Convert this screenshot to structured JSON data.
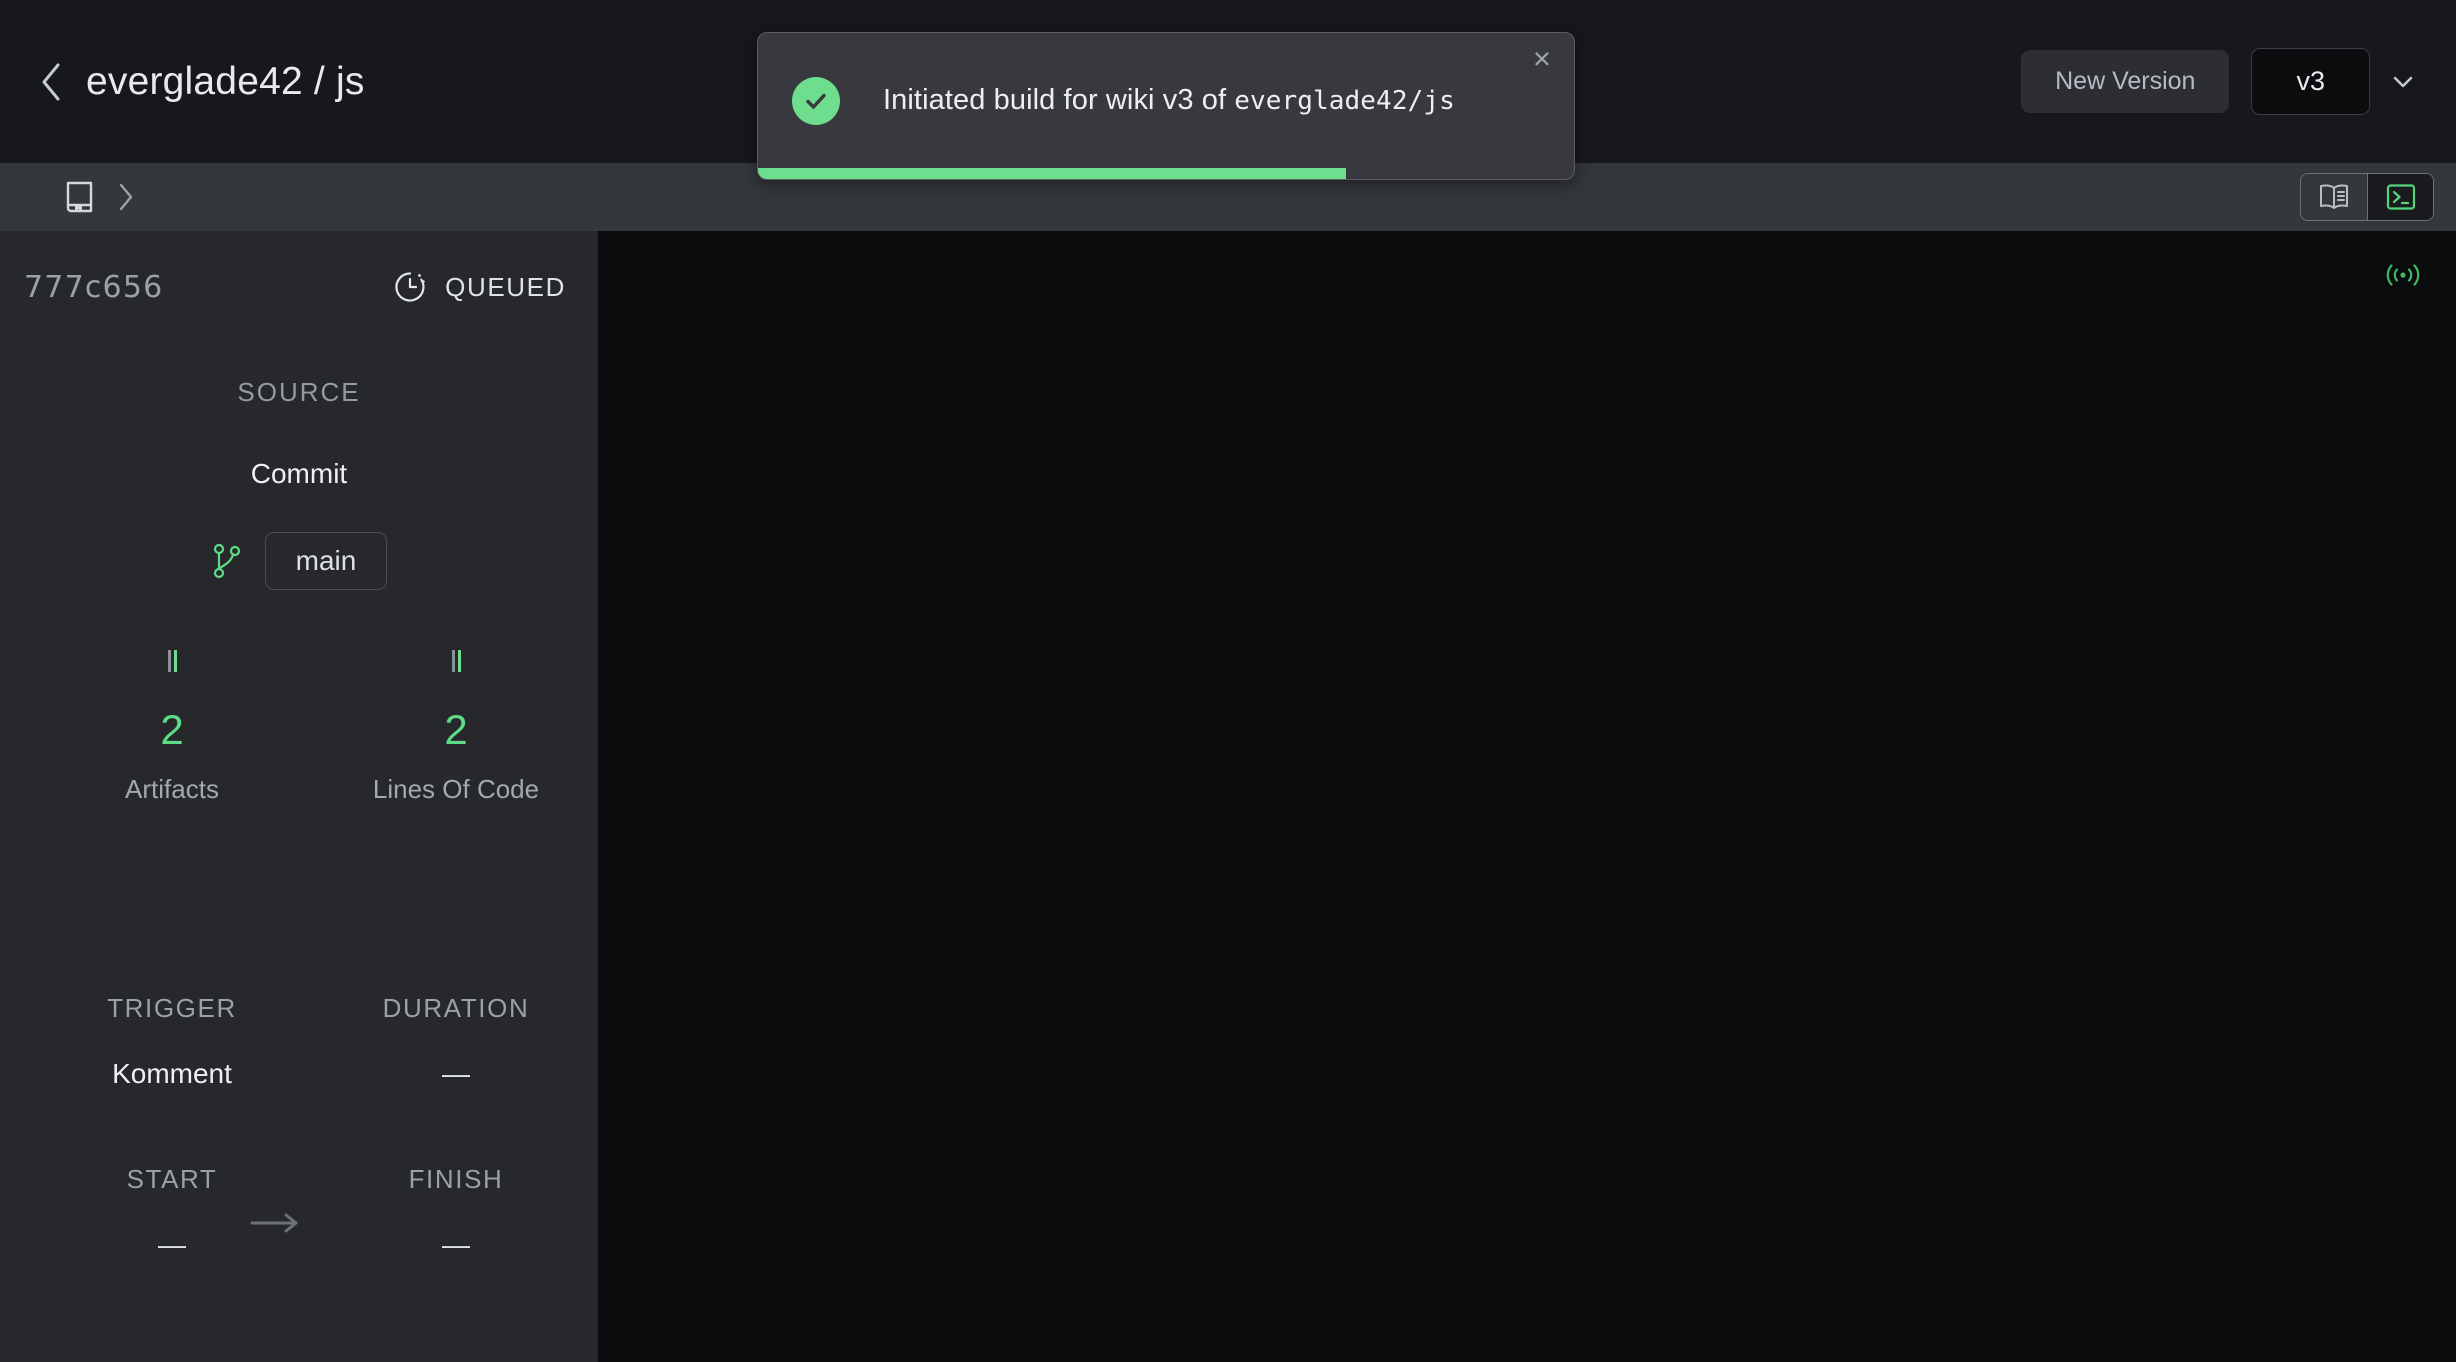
{
  "window": {
    "title": "everglade42 / js",
    "back_icon": "chevron-left-icon"
  },
  "topbar": {
    "new_version_label": "New Version",
    "version_value": "v3",
    "version_chevron_icon": "chevron-down-icon"
  },
  "toast": {
    "status_icon": "check-circle-icon",
    "message_prefix": "Initiated build for wiki v3 of ",
    "message_repo": "everglade42/js",
    "close_label": "×",
    "progress_percent": 72,
    "accent_color": "#6edd8e",
    "background_color": "#37393e"
  },
  "subbar": {
    "book_icon": "book-bookmark-icon",
    "separator_icon": "chevron-right-icon",
    "view_toggle": [
      {
        "icon": "book-open-icon",
        "label": "docs-view",
        "active": false
      },
      {
        "icon": "terminal-icon",
        "label": "terminal-view",
        "active": true
      }
    ]
  },
  "sidebar": {
    "commit_hash": "777c656",
    "status": {
      "icon": "clock-dashed-icon",
      "text": "QUEUED"
    },
    "source": {
      "section_label": "SOURCE",
      "type": "Commit",
      "branch_icon": "git-branch-icon",
      "branch": "main"
    },
    "stats": [
      {
        "value": "2",
        "label": "Artifacts",
        "color": "#5ddc85"
      },
      {
        "value": "2",
        "label": "Lines Of Code",
        "color": "#5ddc85"
      }
    ],
    "meta": [
      {
        "label": "TRIGGER",
        "value": "Komment"
      },
      {
        "label": "DURATION",
        "value": "—"
      }
    ],
    "timing": [
      {
        "label": "START",
        "value": "—"
      },
      {
        "label": "FINISH",
        "value": "—"
      }
    ],
    "timing_arrow_icon": "arrow-right-icon"
  },
  "main": {
    "live_icon": "broadcast-live-icon",
    "live_color": "#3fb964",
    "log_output": ""
  }
}
